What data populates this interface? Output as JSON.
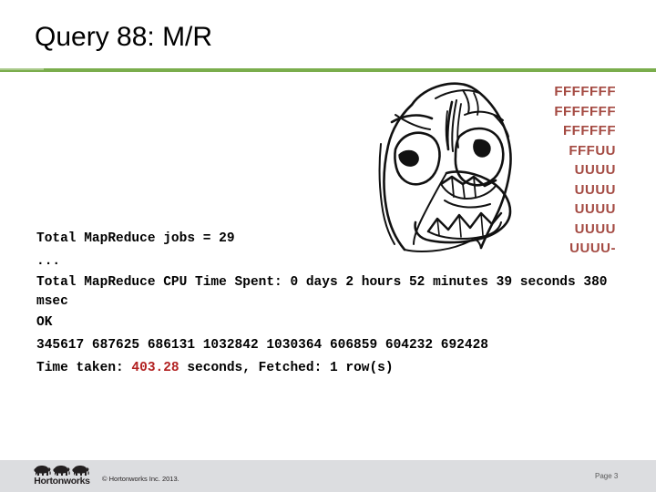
{
  "slide": {
    "title": "Query 88: M/R",
    "accent_color": "#7aad4c",
    "page_label": "Page 3"
  },
  "rage_meme": {
    "alt_name": "rage-face",
    "text_color": "#a44a42",
    "lines": [
      "FFFFFFF",
      "FFFFFFF",
      "FFFFFF",
      "FFFUU",
      "UUUU",
      "UUUU",
      "UUUU",
      "UUUU",
      "UUUU-"
    ]
  },
  "console": {
    "line_1": "Total MapReduce jobs = 29",
    "line_2": "...",
    "line_3": "Total MapReduce CPU Time Spent: 0 days 2 hours 52 minutes 39 seconds 380 msec",
    "line_4": "OK",
    "line_5": "345617 687625 686131 1032842 1030364 606859 604232 692428",
    "line_6_prefix": "Time taken: ",
    "line_6_value": "403.28",
    "line_6_suffix": " seconds, Fetched: 1 row(s)",
    "value_color": "#b22222"
  },
  "footer": {
    "logo_text": "Hortonworks",
    "copyright": "© Hortonworks Inc. 2013.",
    "band_color": "#dcdde0"
  }
}
